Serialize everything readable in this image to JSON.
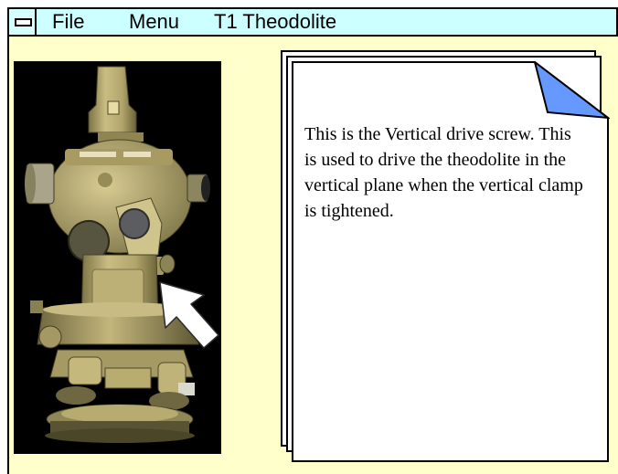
{
  "window": {
    "menu_file": "File",
    "menu_menu": "Menu",
    "title": "T1 Theodolite"
  },
  "image": {
    "subject": "Wild T1 theodolite photograph with arrow pointing to the vertical drive screw",
    "arrow_icon": "arrow-pointer-icon"
  },
  "note": {
    "text": "This is the Vertical drive screw. This is used to drive the theodolite in the vertical plane when the vertical clamp is tightened."
  },
  "colors": {
    "window_background": "#ffffcc",
    "titlebar_background": "#ccffff",
    "page_corner_fold": "#6699ff",
    "instrument_body": "#b9ad72"
  }
}
